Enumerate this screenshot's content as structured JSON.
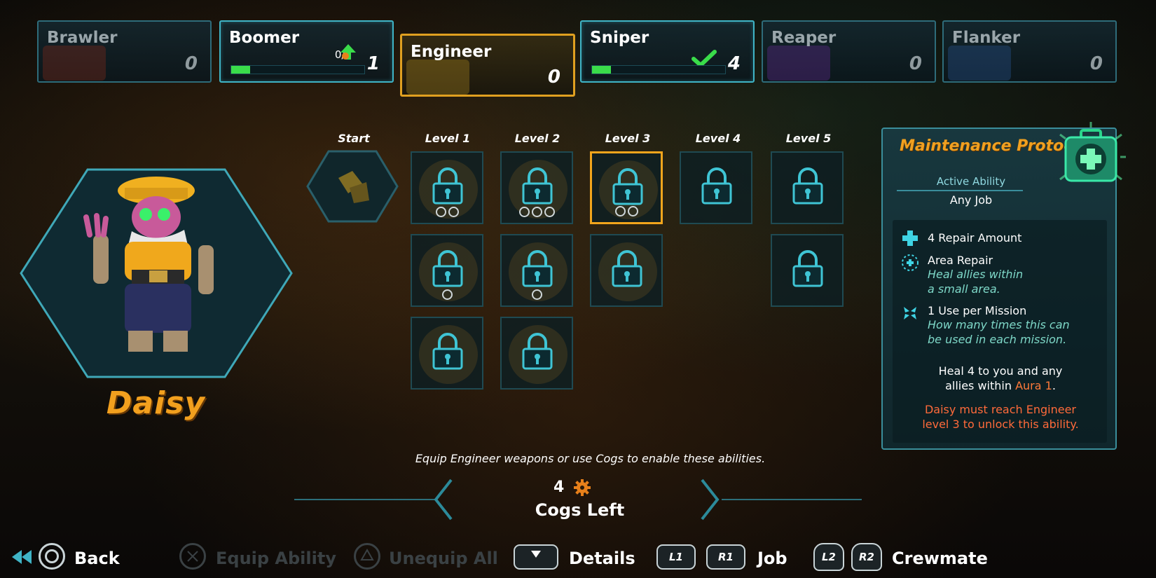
{
  "jobs": [
    {
      "name": "Brawler",
      "level": "0"
    },
    {
      "name": "Boomer",
      "level": "1",
      "progress_text": "0/2",
      "progress": 0.14
    },
    {
      "name": "Engineer",
      "level": "0"
    },
    {
      "name": "Sniper",
      "level": "4",
      "progress": 0.14
    },
    {
      "name": "Reaper",
      "level": "0"
    },
    {
      "name": "Flanker",
      "level": "0"
    }
  ],
  "character": {
    "name": "Daisy"
  },
  "grid": {
    "columns": [
      "Start",
      "Level 1",
      "Level 2",
      "Level 3",
      "Level 4",
      "Level 5"
    ]
  },
  "ability": {
    "title": "Maintenance Protocol",
    "type": "Active Ability",
    "job": "Any Job",
    "stats": [
      {
        "label": "4 Repair Amount",
        "desc": ""
      },
      {
        "label": "Area Repair",
        "desc1": "Heal allies within",
        "desc2": "a small area."
      },
      {
        "label": "1 Use per Mission",
        "desc1": "How many times this can",
        "desc2": "be used in each mission."
      }
    ],
    "heal_line1": "Heal 4 to you and any",
    "heal_line2_pre": "allies within",
    "heal_aura": "Aura 1",
    "heal_line2_post": ".",
    "req_line1": "Daisy must reach Engineer",
    "req_line2": "level 3 to unlock this ability."
  },
  "hint": "Equip Engineer weapons or use Cogs to enable these abilities.",
  "cogs": {
    "count": "4",
    "label": "Cogs Left"
  },
  "controls": {
    "back": "Back",
    "equip": "Equip Ability",
    "unequip": "Unequip All",
    "details": "Details",
    "l1": "L1",
    "r1": "R1",
    "job": "Job",
    "l2": "L2",
    "r2": "R2",
    "crewmate": "Crewmate"
  },
  "colors": {
    "accent": "#3fb4c6",
    "highlight": "#f2a51c",
    "warning": "#ff6a3a",
    "progress": "#3adc4a"
  }
}
